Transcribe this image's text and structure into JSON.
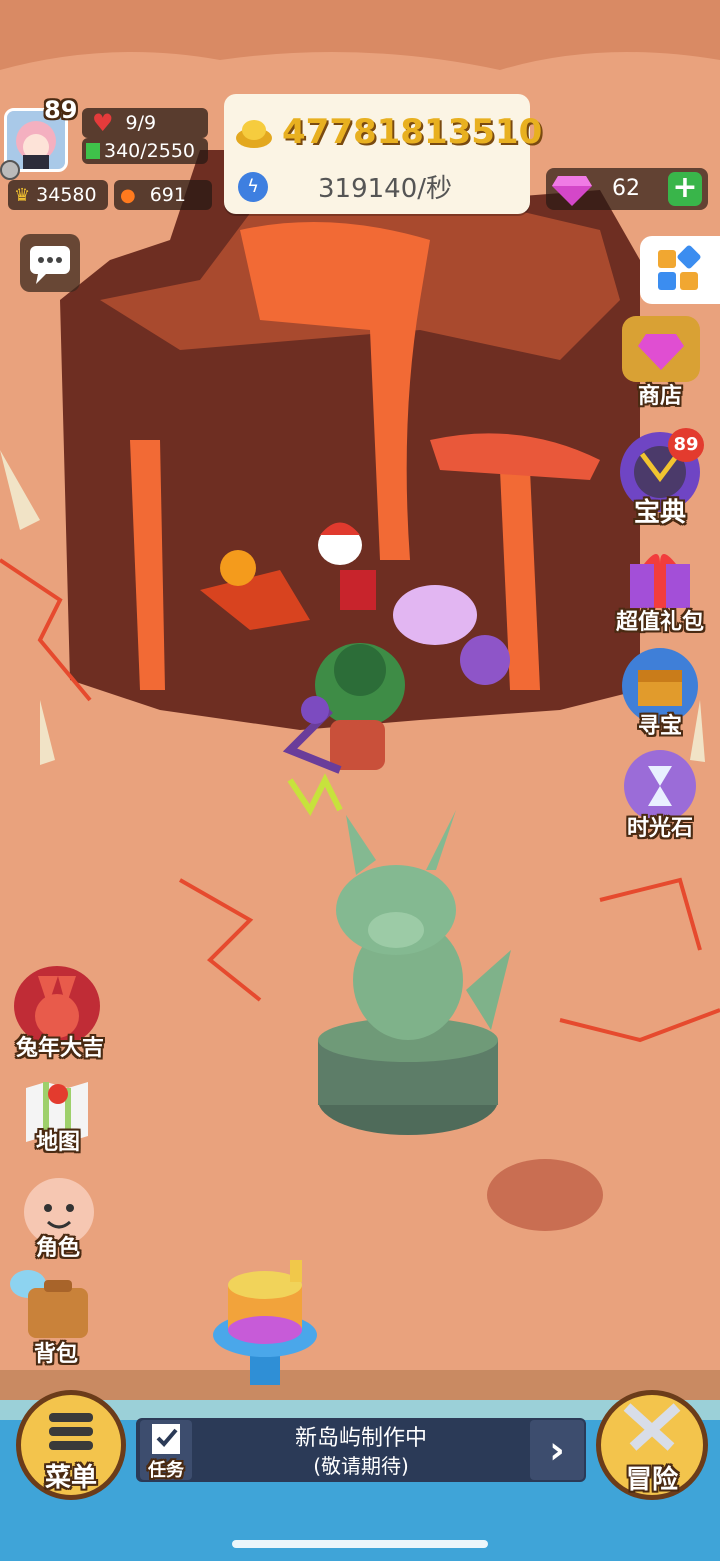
{
  "player": {
    "level": "89",
    "hp": "9/9",
    "energy": "340/2550",
    "crowns": "34580",
    "power": "691"
  },
  "currency": {
    "gold": "47781813510",
    "rate": "319140/秒",
    "gems": "62"
  },
  "right_menu": {
    "shop": "商店",
    "codex": "宝典",
    "codex_badge": "89",
    "gift": "超值礼包",
    "treasure": "寻宝",
    "time_stone": "时光石"
  },
  "left_menu": {
    "event": "兔年大吉",
    "map": "地图",
    "character": "角色",
    "bag": "背包"
  },
  "bottom": {
    "menu": "菜单",
    "quest_tab": "任务",
    "quest_title": "新岛屿制作中",
    "quest_sub": "(敬请期待)",
    "adventure": "冒险"
  },
  "colors": {
    "gold": "#e8b020",
    "plus": "#39b54a",
    "sea": "#3fa4d8",
    "lava": "#f26a35"
  }
}
